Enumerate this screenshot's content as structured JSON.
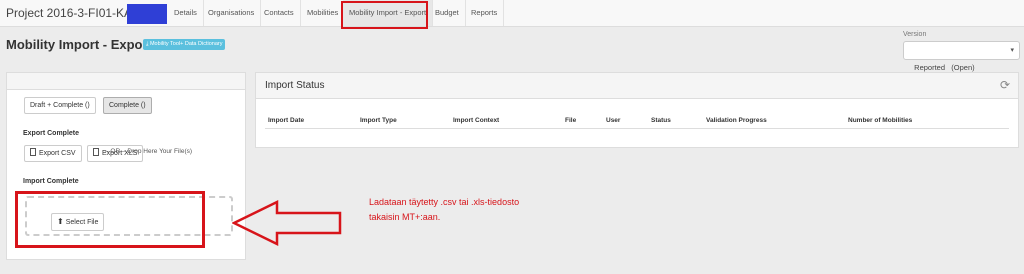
{
  "topbar": {
    "project_title": "Project 2016-3-FI01-KA105",
    "tabs": [
      {
        "label": "Details"
      },
      {
        "label": "Organisations"
      },
      {
        "label": "Contacts"
      },
      {
        "label": "Mobilities"
      },
      {
        "label": "Mobility Import - Export"
      },
      {
        "label": "Budget"
      },
      {
        "label": "Reports"
      }
    ]
  },
  "header": {
    "page_title": "Mobility Import - Export",
    "dictionary_badge": "Mobility Tool+ Data Dictionary",
    "version_label": "Version",
    "version_value": "Reported   (Open)"
  },
  "left": {
    "tabs": [
      {
        "label": "Draft + Complete ()"
      },
      {
        "label": "Complete ()"
      }
    ],
    "export_heading": "Export Complete",
    "export_csv": "Export CSV",
    "export_xls": "Export XLS",
    "import_heading": "Import Complete",
    "select_file": "Select File",
    "drop_text": "– OR – Drop Here Your File(s)"
  },
  "import_status": {
    "title": "Import Status",
    "columns": [
      "Import Date",
      "Import Type",
      "Import Context",
      "File",
      "User",
      "Status",
      "Validation Progress",
      "Number of Mobilities"
    ]
  },
  "annotation": {
    "line1": "Ladataan täytetty .csv tai .xls-tiedosto",
    "line2": "takaisin MT+:aan."
  },
  "colors": {
    "highlight": "#d7141a",
    "badge": "#5bc0de",
    "redaction": "#2f3fd6"
  }
}
